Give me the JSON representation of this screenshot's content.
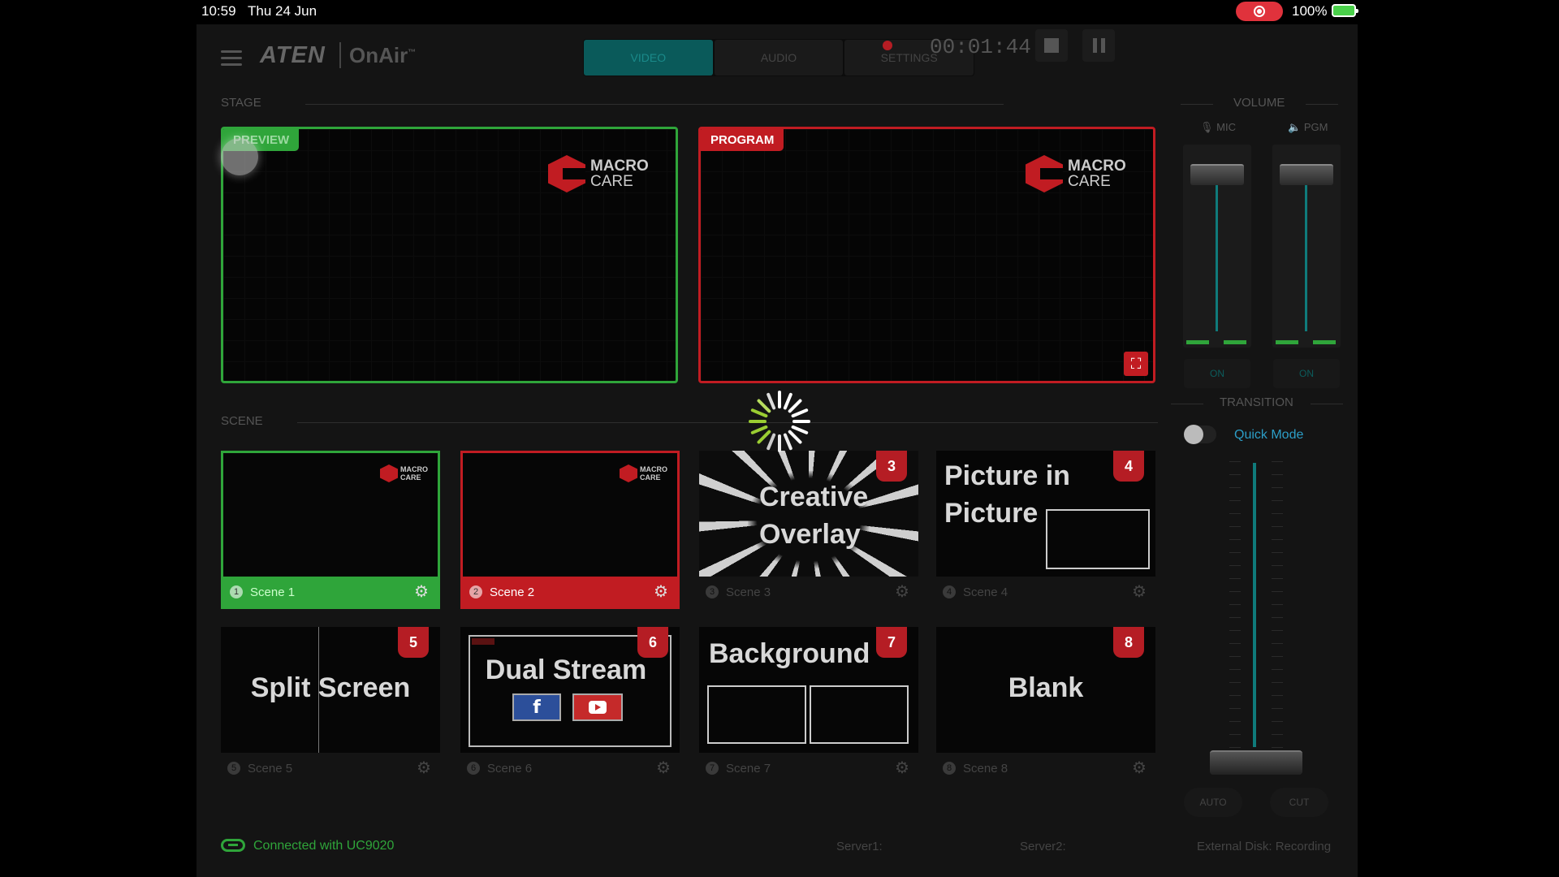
{
  "statusbar": {
    "time": "10:59",
    "date": "Thu 24 Jun",
    "battery": "100%"
  },
  "app": {
    "brand": "ATEN",
    "product": "OnAir",
    "trademark": "™"
  },
  "tabs": [
    {
      "label": "VIDEO",
      "active": true
    },
    {
      "label": "AUDIO",
      "active": false
    },
    {
      "label": "SETTINGS",
      "active": false
    }
  ],
  "record": {
    "elapsed": "00:01:44"
  },
  "stage": {
    "label": "STAGE",
    "preview_label": "PREVIEW",
    "program_label": "PROGRAM",
    "logo_line1": "MACRO",
    "logo_line2": "CARE"
  },
  "scene_section": {
    "label": "SCENE"
  },
  "scenes": [
    {
      "num": "1",
      "name": "Scene 1",
      "title": "",
      "state": "preview"
    },
    {
      "num": "2",
      "name": "Scene 2",
      "title": "",
      "state": "program"
    },
    {
      "num": "3",
      "name": "Scene 3",
      "title_line1": "Creative",
      "title_line2": "Overlay",
      "badge": "3"
    },
    {
      "num": "4",
      "name": "Scene 4",
      "title_line1": "Picture in",
      "title_line2": "Picture",
      "badge": "4"
    },
    {
      "num": "5",
      "name": "Scene 5",
      "title": "Split Screen",
      "badge": "5"
    },
    {
      "num": "6",
      "name": "Scene 6",
      "title": "Dual Stream",
      "badge": "6"
    },
    {
      "num": "7",
      "name": "Scene 7",
      "title": "Background",
      "badge": "7"
    },
    {
      "num": "8",
      "name": "Scene 8",
      "title": "Blank",
      "badge": "8"
    }
  ],
  "mini_logo": {
    "line1": "MACRO",
    "line2": "CARE"
  },
  "volume": {
    "label": "VOLUME",
    "mic_label": "MIC",
    "pgm_label": "PGM",
    "mic_on": "ON",
    "pgm_on": "ON",
    "mic_level": 0.85,
    "pgm_level": 0.85
  },
  "transition": {
    "label": "TRANSITION",
    "quick_mode": "Quick Mode",
    "auto_label": "AUTO",
    "cut_label": "CUT"
  },
  "footer": {
    "connection": "Connected with UC9020",
    "server1_label": "Server1:",
    "server2_label": "Server2:",
    "external_disk": "External Disk: Recording"
  },
  "colors": {
    "preview": "#2fa53a",
    "program": "#c11c22",
    "accent": "#2c9ec7"
  }
}
